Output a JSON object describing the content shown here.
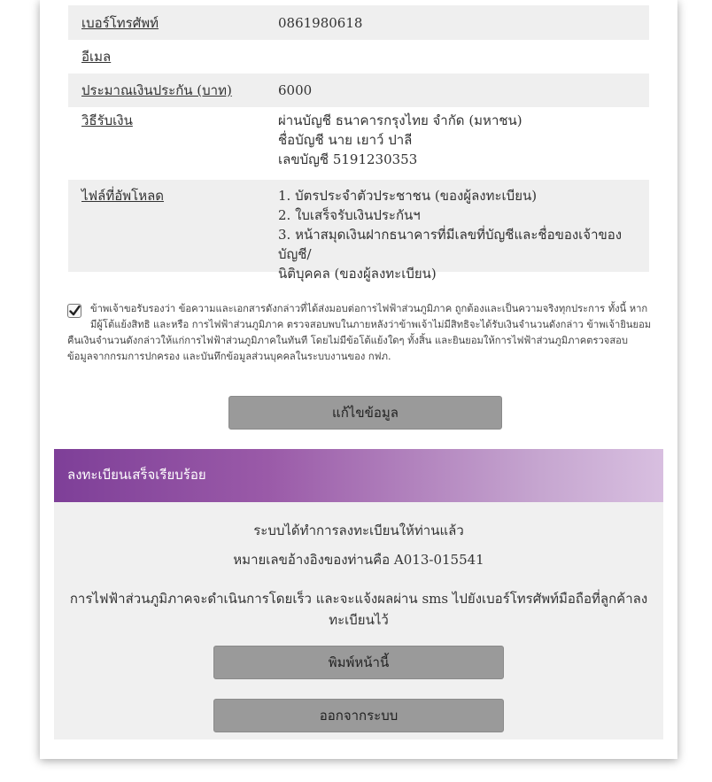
{
  "details": [
    {
      "label": "เบอร์โทรศัพท์",
      "value_lines": [
        "0861980618"
      ]
    },
    {
      "label": "อีเมล",
      "value_lines": []
    },
    {
      "label": "ประมาณเงินประกัน (บาท)",
      "value_lines": [
        "6000"
      ]
    },
    {
      "label": "วิธีรับเงิน",
      "value_lines": [
        "ผ่านบัญชี ธนาคารกรุงไทย จำกัด (มหาชน)",
        "ชื่อบัญชี นาย เยาว์ ปาลี",
        "เลขบัญชี 5191230353"
      ]
    },
    {
      "label": "ไฟล์ที่อัพโหลด",
      "value_lines": [
        "1. บัตรประจำตัวประชาชน (ของผู้ลงทะเบียน)",
        "2. ใบเสร็จรับเงินประกันฯ",
        "3. หน้าสมุดเงินฝากธนาคารที่มีเลขที่บัญชีและชื่อของเจ้าของบัญชี/",
        "นิติบุคคล (ของผู้ลงทะเบียน)"
      ]
    }
  ],
  "consent": {
    "checked": true,
    "text": "ข้าพเจ้าขอรับรองว่า ข้อความและเอกสารดังกล่าวที่ได้ส่งมอบต่อการไฟฟ้าส่วนภูมิภาค ถูกต้องและเป็นความจริงทุกประการ ทั้งนี้ หากมีผู้โต้แย้งสิทธิ และหรือ การไฟฟ้าส่วนภูมิภาค ตรวจสอบพบในภายหลังว่าข้าพเจ้าไม่มีสิทธิจะได้รับเงินจำนวนดังกล่าว ข้าพเจ้ายินยอมคืนเงินจำนวนดังกล่าวให้แก่การไฟฟ้าส่วนภูมิภาคในทันที โดยไม่มีข้อโต้แย้งใดๆ ทั้งสิ้น และยินยอมให้การไฟฟ้าส่วนภูมิภาคตรวจสอบข้อมูลจากกรมการปกครอง และบันทึกข้อมูลส่วนบุคคลในระบบงานของ กฟภ."
  },
  "edit_button": "แก้ไขข้อมูล",
  "success": {
    "header": "ลงทะเบียนเสร็จเรียบร้อย",
    "line1": "ระบบได้ทำการลงทะเบียนให้ท่านแล้ว",
    "line2": "หมายเลขอ้างอิงของท่านคือ A013-015541",
    "line3": "การไฟฟ้าส่วนภูมิภาคจะดำเนินการโดยเร็ว และจะแจ้งผลผ่าน sms ไปยังเบอร์โทรศัพท์มือถือที่ลูกค้าลงทะเบียนไว้",
    "print_button": "พิมพ์หน้านี้",
    "logout_button": "ออกจากระบบ"
  },
  "colors": {
    "header_gradient_start": "#7e3f98",
    "header_gradient_end": "#d8bfe0",
    "button_gray": "#9a9a9a"
  }
}
